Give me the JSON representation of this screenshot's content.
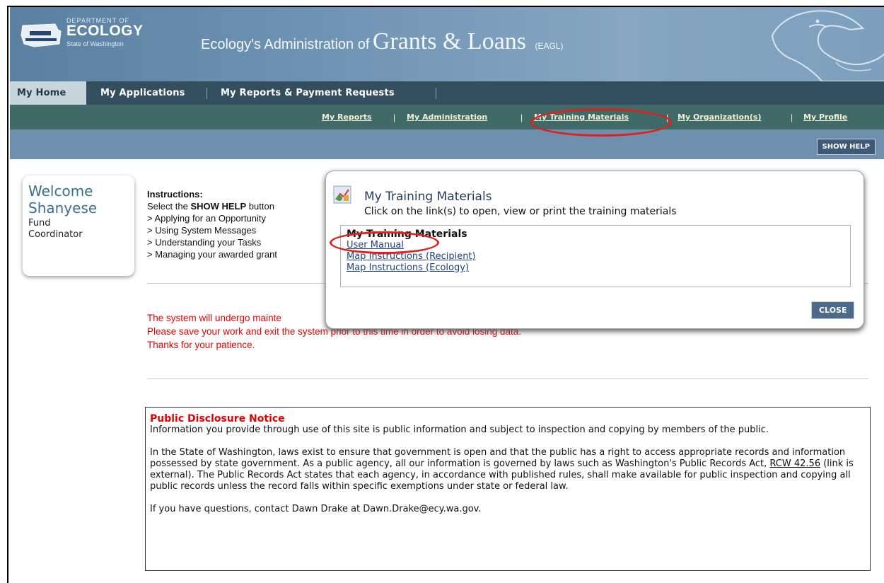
{
  "header": {
    "logo": {
      "line1": "DEPARTMENT OF",
      "line2": "ECOLOGY",
      "line3": "State of Washington"
    },
    "title_prefix": "Ecology's Administration of",
    "title_main": "Grants & Loans",
    "title_abbr": "(EAGL)"
  },
  "tabs": [
    {
      "label": "My Home"
    },
    {
      "label": "My Applications"
    },
    {
      "label": "My Reports & Payment Requests"
    }
  ],
  "subnav": [
    {
      "label": "My Reports"
    },
    {
      "label": "My Administration"
    },
    {
      "label": "My Training Materials"
    },
    {
      "label": "My Organization(s)"
    },
    {
      "label": "My Profile"
    }
  ],
  "subnav_sep": "|",
  "help_button": "SHOW HELP",
  "welcome": {
    "greeting": "Welcome",
    "name": "Shanyese",
    "role_line1": "Fund",
    "role_line2": "Coordinator"
  },
  "instructions": {
    "title": "Instructions:",
    "intro_pre": "Select the ",
    "intro_bold": "SHOW HELP",
    "intro_post": " button",
    "items": [
      "> Applying for an Opportunity",
      "> Using System Messages",
      "> Understanding your Tasks",
      "> Managing your awarded grant"
    ]
  },
  "maintenance": {
    "line1": "The system will undergo mainte",
    "line2": "Please save your work and exit the system prior to this time in order to avoid losing data.",
    "line3": "Thanks for your patience."
  },
  "notice": {
    "title": "Public Disclosure Notice",
    "p1": "Information you provide through use of this site is public information and subject to inspection and copying by members of the public.",
    "p2_pre": "In the State of Washington, laws exist to ensure that government is open and that the public has a right to access appropriate records and information possessed by state government. As a public agency, all our information is governed by laws such as Washington's Public Records Act, ",
    "p2_link": "RCW 42.56",
    "p2_post": " (link is external). The Public Records Act states that each agency, in accordance with published rules, shall make available for public inspection and copying all public records unless the record falls within specific exemptions under state or federal law.",
    "p3": "If you have questions, contact Dawn Drake at Dawn.Drake@ecy.wa.gov."
  },
  "modal": {
    "title": "My Training Materials",
    "description": "Click on the link(s) to open, view or print the training materials",
    "box_heading": "My Training Materials",
    "links": [
      "User Manual",
      "Map Instructions (Recipient)",
      "Map Instructions (Ecology)"
    ],
    "close_label": "CLOSE"
  },
  "colors": {
    "highlight_oval": "#e0201c",
    "maintenance_text": "#e50000",
    "tabbar": "#334f5f",
    "subnav": "#3f6a67"
  }
}
